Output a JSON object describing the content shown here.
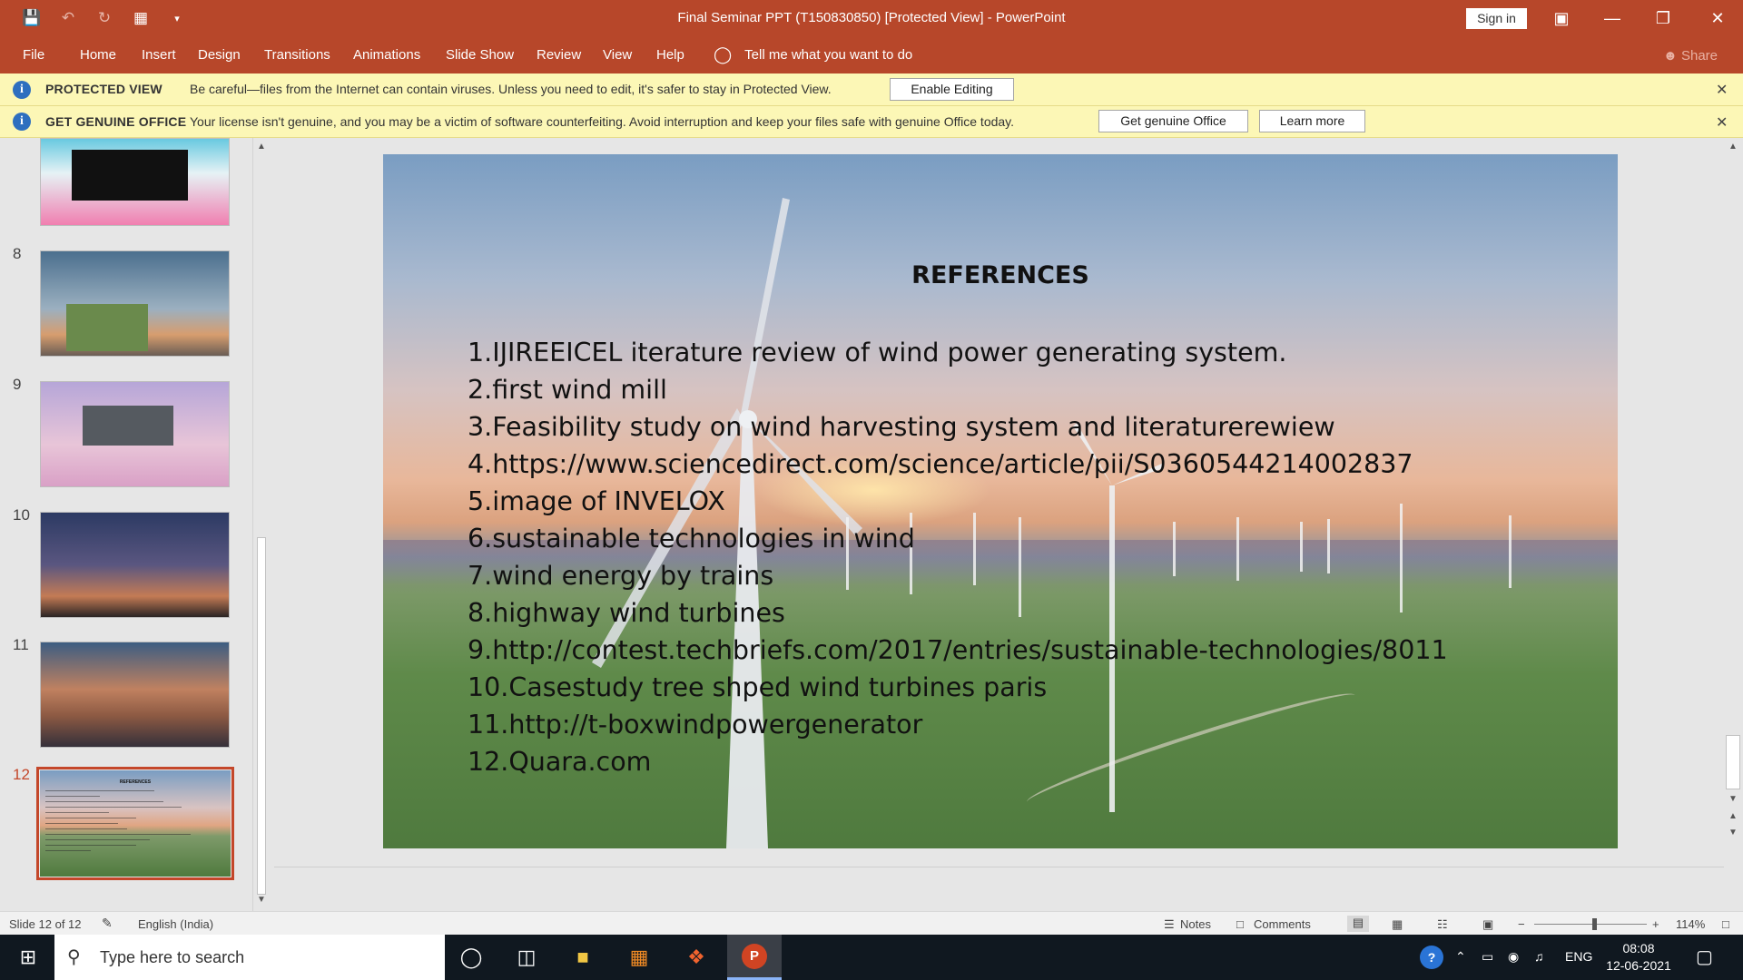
{
  "window": {
    "title": "Final Seminar PPT (T150830850) [Protected View]  -  PowerPoint",
    "sign_in": "Sign in"
  },
  "qat": {
    "icons": [
      "save-icon",
      "undo-icon",
      "redo-icon",
      "present-icon",
      "customize-icon"
    ]
  },
  "ribbon": {
    "tabs": [
      "File",
      "Home",
      "Insert",
      "Design",
      "Transitions",
      "Animations",
      "Slide Show",
      "Review",
      "View",
      "Help"
    ],
    "tell_me": "Tell me what you want to do",
    "share": "Share"
  },
  "protected_view": {
    "label": "PROTECTED VIEW",
    "message": "Be careful—files from the Internet can contain viruses. Unless you need to edit, it's safer to stay in Protected View.",
    "enable_button": "Enable Editing"
  },
  "genuine": {
    "label": "GET GENUINE OFFICE",
    "message": "Your license isn't genuine, and you may be a victim of software counterfeiting. Avoid interruption and keep your files safe with genuine Office today.",
    "get_button": "Get genuine Office",
    "learn_button": "Learn more"
  },
  "thumbnails": {
    "numbers": [
      "8",
      "9",
      "10",
      "11",
      "12"
    ],
    "active": "12"
  },
  "slide": {
    "heading": "REFERENCES",
    "items": [
      "1.IJIREEICEL iterature review of wind power generating system.",
      "2.first wind mill",
      "3.Feasibility study on wind harvesting system and literaturerewiew",
      "4.https://www.sciencedirect.com/science/article/pii/S0360544214002837",
      "5.image of INVELOX",
      "6.sustainable technologies in wind",
      "7.wind energy by trains",
      "8.highway wind turbines",
      "9.http://contest.techbriefs.com/2017/entries/sustainable-technologies/8011",
      "10.Casestudy tree shped wind turbines paris",
      "11.http://t-boxwindpowergenerator",
      "12.Quara.com"
    ]
  },
  "status": {
    "slide_info": "Slide 12 of 12",
    "language": "English (India)",
    "notes": "Notes",
    "comments": "Comments",
    "zoom": "114%"
  },
  "taskbar": {
    "search_placeholder": "Type here to search",
    "lang": "ENG",
    "time": "08:08",
    "date": "12-06-2021"
  }
}
